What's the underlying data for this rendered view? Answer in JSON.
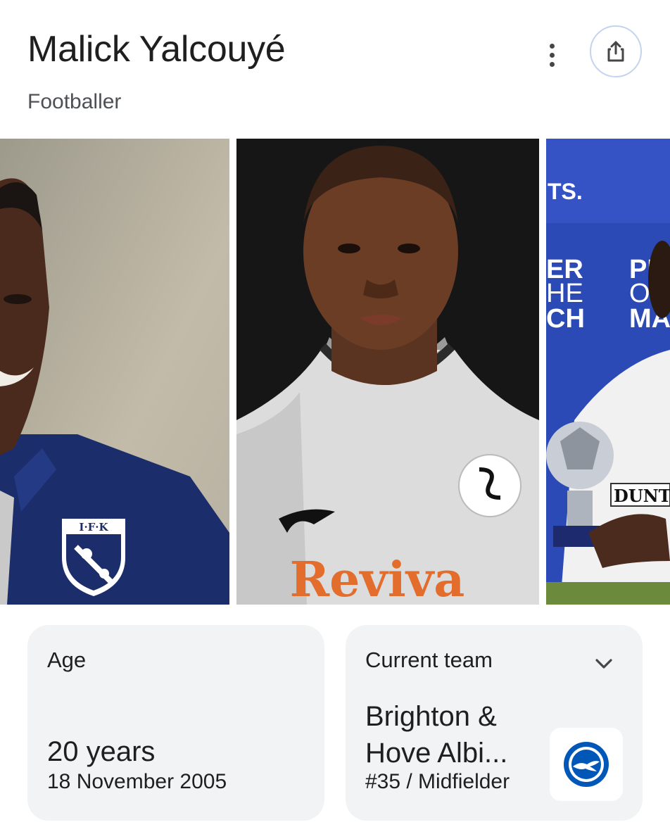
{
  "header": {
    "name": "Malick Yalcouyé",
    "description": "Footballer"
  },
  "icons": {
    "more": "more-vert-icon",
    "share": "share-icon",
    "expand": "chevron-down-icon"
  },
  "age_card": {
    "label": "Age",
    "value": "20 years",
    "date": "18 November 2005"
  },
  "team_card": {
    "label": "Current team",
    "name": "Brighton & Hove Albi...",
    "detail": "#35 / Midfielder",
    "crest_colors": {
      "blue": "#0057b8",
      "white": "#ffffff"
    }
  },
  "images": {
    "photo1": {
      "badge": "I·F·K"
    },
    "photo2": {
      "sponsor": "Reviva"
    },
    "photo3": {
      "board_fragment": "TS.",
      "text_a": [
        "ER",
        "HE",
        "CH"
      ],
      "text_b": [
        "PL",
        "O",
        "MA"
      ],
      "jersey": "DUNT"
    }
  },
  "colors": {
    "accent_border": "#c4d3ef",
    "card_bg": "#f1f3f4",
    "text_primary": "#1f1f1f",
    "text_secondary": "#4d5156"
  }
}
